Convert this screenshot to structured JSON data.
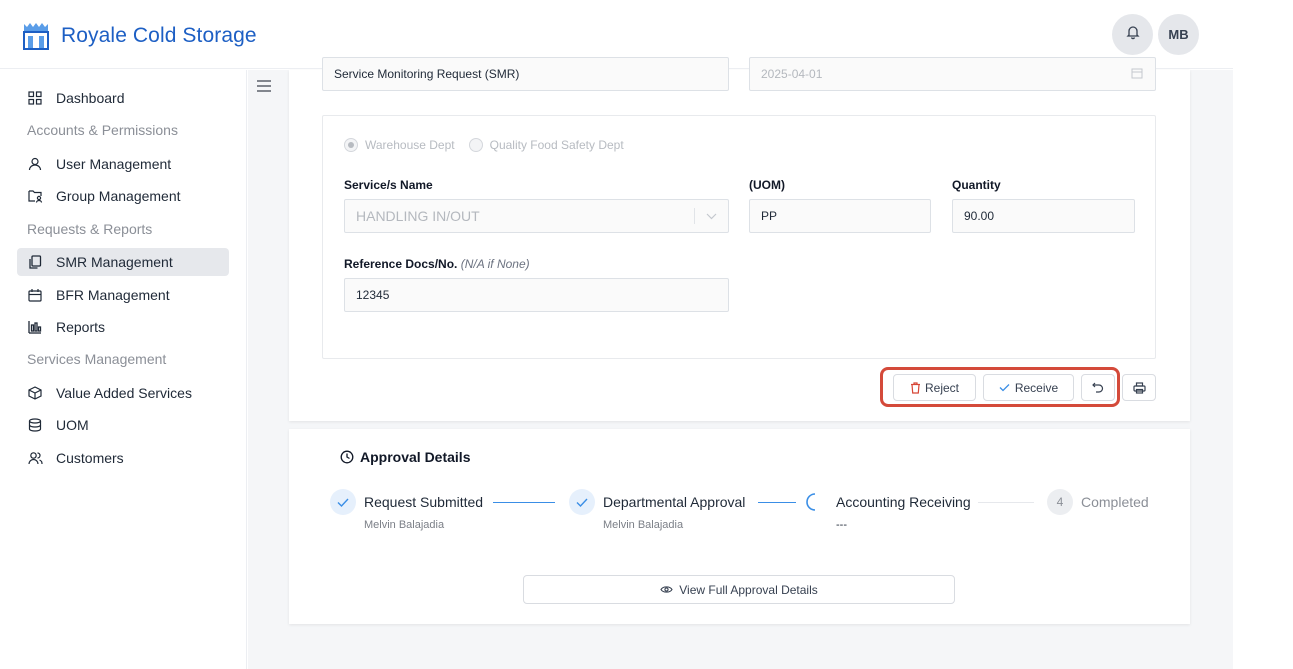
{
  "app": {
    "brand": "Royale Cold Storage",
    "user_initials": "MB"
  },
  "sidebar": {
    "items": [
      {
        "label": "Dashboard",
        "icon": "dashboard-grid-icon"
      },
      {
        "label": "User Management",
        "icon": "user-icon"
      },
      {
        "label": "Group Management",
        "icon": "folder-user-icon"
      },
      {
        "label": "SMR Management",
        "icon": "copy-documents-icon",
        "active": true
      },
      {
        "label": "BFR Management",
        "icon": "calendar-box-icon"
      },
      {
        "label": "Reports",
        "icon": "bar-chart-icon"
      },
      {
        "label": "Value Added Services",
        "icon": "cube-icon"
      },
      {
        "label": "UOM",
        "icon": "database-icon"
      },
      {
        "label": "Customers",
        "icon": "users-icon"
      }
    ],
    "sections": [
      "Accounts & Permissions",
      "Requests & Reports",
      "Services Management"
    ]
  },
  "form": {
    "request_type": "Service Monitoring Request (SMR)",
    "date": "2025-04-01",
    "departments": [
      "Warehouse Dept",
      "Quality Food Safety Dept"
    ],
    "service_label": "Service/s Name",
    "service_value": "HANDLING IN/OUT",
    "uom_label": "(UOM)",
    "uom_value": "PP",
    "quantity_label": "Quantity",
    "quantity_value": "90.00",
    "ref_label": "Reference Docs/No.",
    "ref_hint": "(N/A if None)",
    "ref_value": "12345"
  },
  "actions": {
    "reject": "Reject",
    "receive": "Receive"
  },
  "approval": {
    "title": "Approval Details",
    "steps": [
      {
        "title": "Request Submitted",
        "sub": "Melvin Balajadia",
        "status": "done"
      },
      {
        "title": "Departmental Approval",
        "sub": "Melvin Balajadia",
        "status": "done"
      },
      {
        "title": "Accounting Receiving",
        "sub": "---",
        "status": "in-progress"
      },
      {
        "title": "Completed",
        "number": "4",
        "status": "wait"
      }
    ],
    "view_button": "View Full Approval Details"
  },
  "colors": {
    "brand": "#1d5fc4",
    "highlight": "#d44a3a",
    "active_bg": "#e6e8ec",
    "step_done": "#3a8ee6"
  }
}
